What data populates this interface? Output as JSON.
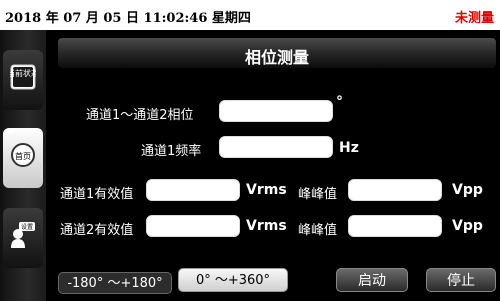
{
  "status_bar": {
    "datetime": "2018 年 07 月 05 日  11:02:46  星期四",
    "status": "未测量"
  },
  "sidebar": {
    "items": [
      {
        "label": "当前状态",
        "icon": "current-status-icon"
      },
      {
        "label": "首页",
        "icon": "home-icon"
      },
      {
        "label": "设置",
        "icon": "settings-person-icon"
      }
    ]
  },
  "main": {
    "title": "相位测量",
    "rows": {
      "phase": {
        "label": "通道1～通道2相位",
        "value": "",
        "unit": "°"
      },
      "freq": {
        "label": "通道1频率",
        "value": "",
        "unit": "Hz"
      },
      "ch1_rms": {
        "label": "通道1有效值",
        "value": "",
        "unit": "Vrms"
      },
      "ch1_pp": {
        "label": "峰峰值",
        "value": "",
        "unit": "Vpp"
      },
      "ch2_rms": {
        "label": "通道2有效值",
        "value": "",
        "unit": "Vrms"
      },
      "ch2_pp": {
        "label": "峰峰值",
        "value": "",
        "unit": "Vpp"
      }
    },
    "range_options": [
      "-180° ～+180°",
      "0° ～+360°"
    ],
    "selected_range": "0° ～+360°",
    "start_label": "启动",
    "stop_label": "停止"
  },
  "colors": {
    "status_red": "#e00000",
    "field_white": "#ffffff"
  }
}
